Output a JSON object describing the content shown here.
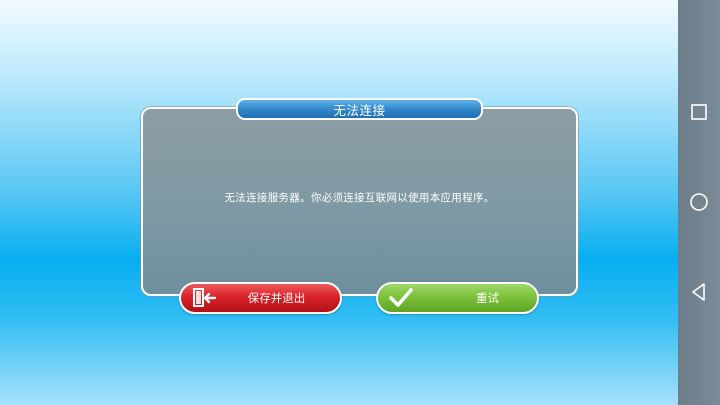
{
  "dialog": {
    "title": "无法连接",
    "message": "无法连接服务器。你必须连接互联网以使用本应用程序。",
    "buttons": {
      "quit_label": "保存并退出",
      "retry_label": "重试"
    }
  },
  "colors": {
    "quit_button": "#d72229",
    "retry_button": "#7cc23b",
    "title_bar": "#2f86c8",
    "panel": "#809aa4",
    "nav_bar": "#76868f"
  },
  "icons": {
    "quit": "exit-door-icon",
    "retry": "checkmark-icon",
    "nav_recents": "square-icon",
    "nav_home": "circle-icon",
    "nav_back": "triangle-back-icon"
  }
}
